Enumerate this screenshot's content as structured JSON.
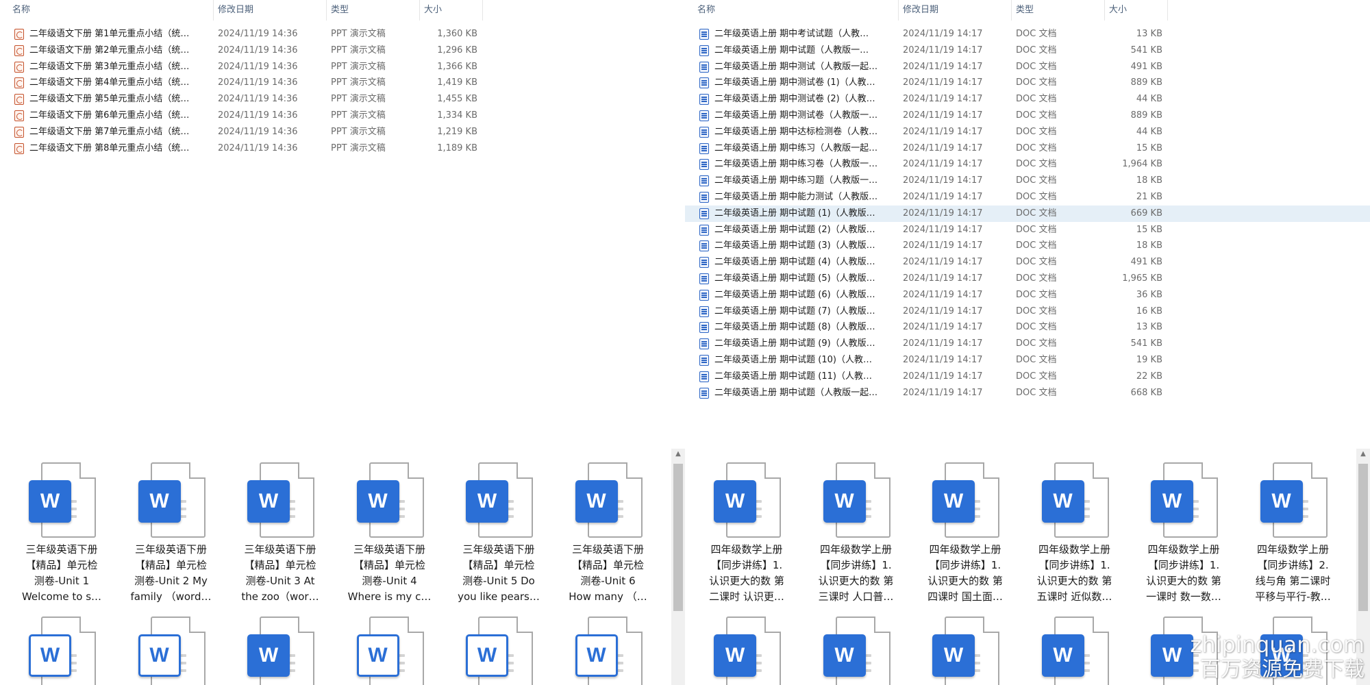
{
  "left_list": {
    "headers": [
      "名称",
      "修改日期",
      "类型",
      "大小"
    ],
    "rows": [
      {
        "name": "二年级语文下册  第1单元重点小结（统…",
        "date": "2024/11/19 14:36",
        "type": "PPT 演示文稿",
        "size": "1,360 KB",
        "icon": "ppt-file-icon"
      },
      {
        "name": "二年级语文下册  第2单元重点小结（统…",
        "date": "2024/11/19 14:36",
        "type": "PPT 演示文稿",
        "size": "1,296 KB",
        "icon": "ppt-file-icon"
      },
      {
        "name": "二年级语文下册  第3单元重点小结（统…",
        "date": "2024/11/19 14:36",
        "type": "PPT 演示文稿",
        "size": "1,366 KB",
        "icon": "ppt-file-icon"
      },
      {
        "name": "二年级语文下册  第4单元重点小结（统…",
        "date": "2024/11/19 14:36",
        "type": "PPT 演示文稿",
        "size": "1,419 KB",
        "icon": "ppt-file-icon"
      },
      {
        "name": "二年级语文下册  第5单元重点小结（统…",
        "date": "2024/11/19 14:36",
        "type": "PPT 演示文稿",
        "size": "1,455 KB",
        "icon": "ppt-file-icon"
      },
      {
        "name": "二年级语文下册  第6单元重点小结（统…",
        "date": "2024/11/19 14:36",
        "type": "PPT 演示文稿",
        "size": "1,334 KB",
        "icon": "ppt-file-icon"
      },
      {
        "name": "二年级语文下册  第7单元重点小结（统…",
        "date": "2024/11/19 14:36",
        "type": "PPT 演示文稿",
        "size": "1,219 KB",
        "icon": "ppt-file-icon"
      },
      {
        "name": "二年级语文下册  第8单元重点小结（统…",
        "date": "2024/11/19 14:36",
        "type": "PPT 演示文稿",
        "size": "1,189 KB",
        "icon": "ppt-file-icon"
      }
    ]
  },
  "right_list": {
    "headers": [
      "名称",
      "修改日期",
      "类型",
      "大小"
    ],
    "selected_index": 11,
    "rows": [
      {
        "name": "二年级英语上册    期中考试试题（人教…",
        "date": "2024/11/19 14:17",
        "type": "DOC 文档",
        "size": "13 KB"
      },
      {
        "name": "二年级英语上册    期中试题（人教版一…",
        "date": "2024/11/19 14:17",
        "type": "DOC 文档",
        "size": "541 KB"
      },
      {
        "name": "二年级英语上册  期中测试（人教版一起…",
        "date": "2024/11/19 14:17",
        "type": "DOC 文档",
        "size": "491 KB"
      },
      {
        "name": "二年级英语上册  期中测试卷 (1)（人教…",
        "date": "2024/11/19 14:17",
        "type": "DOC 文档",
        "size": "889 KB"
      },
      {
        "name": "二年级英语上册  期中测试卷 (2)（人教…",
        "date": "2024/11/19 14:17",
        "type": "DOC 文档",
        "size": "44 KB"
      },
      {
        "name": "二年级英语上册  期中测试卷（人教版一…",
        "date": "2024/11/19 14:17",
        "type": "DOC 文档",
        "size": "889 KB"
      },
      {
        "name": "二年级英语上册  期中达标检测卷（人教…",
        "date": "2024/11/19 14:17",
        "type": "DOC 文档",
        "size": "44 KB"
      },
      {
        "name": "二年级英语上册  期中练习（人教版一起…",
        "date": "2024/11/19 14:17",
        "type": "DOC 文档",
        "size": "15 KB"
      },
      {
        "name": "二年级英语上册  期中练习卷（人教版一…",
        "date": "2024/11/19 14:17",
        "type": "DOC 文档",
        "size": "1,964 KB"
      },
      {
        "name": "二年级英语上册  期中练习题（人教版一…",
        "date": "2024/11/19 14:17",
        "type": "DOC 文档",
        "size": "18 KB"
      },
      {
        "name": "二年级英语上册  期中能力测试（人教版…",
        "date": "2024/11/19 14:17",
        "type": "DOC 文档",
        "size": "21 KB"
      },
      {
        "name": "二年级英语上册  期中试题 (1)（人教版…",
        "date": "2024/11/19 14:17",
        "type": "DOC 文档",
        "size": "669 KB"
      },
      {
        "name": "二年级英语上册  期中试题 (2)（人教版…",
        "date": "2024/11/19 14:17",
        "type": "DOC 文档",
        "size": "15 KB"
      },
      {
        "name": "二年级英语上册  期中试题 (3)（人教版…",
        "date": "2024/11/19 14:17",
        "type": "DOC 文档",
        "size": "18 KB"
      },
      {
        "name": "二年级英语上册  期中试题 (4)（人教版…",
        "date": "2024/11/19 14:17",
        "type": "DOC 文档",
        "size": "491 KB"
      },
      {
        "name": "二年级英语上册  期中试题 (5)（人教版…",
        "date": "2024/11/19 14:17",
        "type": "DOC 文档",
        "size": "1,965 KB"
      },
      {
        "name": "二年级英语上册  期中试题 (6)（人教版…",
        "date": "2024/11/19 14:17",
        "type": "DOC 文档",
        "size": "36 KB"
      },
      {
        "name": "二年级英语上册  期中试题 (7)（人教版…",
        "date": "2024/11/19 14:17",
        "type": "DOC 文档",
        "size": "16 KB"
      },
      {
        "name": "二年级英语上册  期中试题 (8)（人教版…",
        "date": "2024/11/19 14:17",
        "type": "DOC 文档",
        "size": "13 KB"
      },
      {
        "name": "二年级英语上册  期中试题 (9)（人教版…",
        "date": "2024/11/19 14:17",
        "type": "DOC 文档",
        "size": "541 KB"
      },
      {
        "name": "二年级英语上册  期中试题 (10)（人教…",
        "date": "2024/11/19 14:17",
        "type": "DOC 文档",
        "size": "19 KB"
      },
      {
        "name": "二年级英语上册  期中试题 (11)（人教…",
        "date": "2024/11/19 14:17",
        "type": "DOC 文档",
        "size": "22 KB"
      },
      {
        "name": "二年级英语上册  期中试题（人教版一起…",
        "date": "2024/11/19 14:17",
        "type": "DOC 文档",
        "size": "668 KB"
      }
    ]
  },
  "left_grid": {
    "tiles": [
      {
        "lines": [
          "三年级英语下册",
          "【精品】单元检",
          "测卷-Unit 1",
          "Welcome to s…"
        ],
        "style": "solid"
      },
      {
        "lines": [
          "三年级英语下册",
          "【精品】单元检",
          "测卷-Unit 2 My",
          "family （word…"
        ],
        "style": "solid"
      },
      {
        "lines": [
          "三年级英语下册",
          "【精品】单元检",
          "测卷-Unit 3 At",
          "the zoo（wor…"
        ],
        "style": "solid"
      },
      {
        "lines": [
          "三年级英语下册",
          "【精品】单元检",
          "测卷-Unit 4",
          "Where is my c…"
        ],
        "style": "solid"
      },
      {
        "lines": [
          "三年级英语下册",
          "【精品】单元检",
          "测卷-Unit 5 Do",
          "you like pears…"
        ],
        "style": "solid"
      },
      {
        "lines": [
          "三年级英语下册",
          "【精品】单元检",
          "测卷-Unit 6",
          "How many （…"
        ],
        "style": "solid"
      },
      {
        "lines": [],
        "style": "light"
      },
      {
        "lines": [],
        "style": "light"
      },
      {
        "lines": [],
        "style": "solid"
      },
      {
        "lines": [],
        "style": "light"
      },
      {
        "lines": [],
        "style": "light"
      },
      {
        "lines": [],
        "style": "light"
      }
    ]
  },
  "right_grid": {
    "tiles": [
      {
        "lines": [
          "四年级数学上册",
          "【同步讲练】1.",
          "认识更大的数 第",
          "二课时  认识更…"
        ],
        "style": "solid"
      },
      {
        "lines": [
          "四年级数学上册",
          "【同步讲练】1.",
          "认识更大的数 第",
          "三课时  人口普…"
        ],
        "style": "solid"
      },
      {
        "lines": [
          "四年级数学上册",
          "【同步讲练】1.",
          "认识更大的数 第",
          "四课时  国土面…"
        ],
        "style": "solid"
      },
      {
        "lines": [
          "四年级数学上册",
          "【同步讲练】1.",
          "认识更大的数 第",
          "五课时  近似数…"
        ],
        "style": "solid"
      },
      {
        "lines": [
          "四年级数学上册",
          "【同步讲练】1.",
          "认识更大的数 第",
          "一课时  数一数…"
        ],
        "style": "solid"
      },
      {
        "lines": [
          "四年级数学上册",
          "【同步讲练】2.",
          "线与角 第二课时",
          "平移与平行-教…"
        ],
        "style": "solid"
      },
      {
        "lines": [],
        "style": "solid"
      },
      {
        "lines": [],
        "style": "solid"
      },
      {
        "lines": [],
        "style": "solid"
      },
      {
        "lines": [],
        "style": "solid"
      },
      {
        "lines": [],
        "style": "solid"
      },
      {
        "lines": [],
        "style": "solid"
      }
    ]
  },
  "icon_letter": "W",
  "watermark": {
    "line1": "zhipinquan.com",
    "line2": "百万资源免费下载"
  },
  "colors": {
    "selection": "#e5eff7",
    "word_blue": "#2b6fd6",
    "header_text": "#4c607a"
  }
}
